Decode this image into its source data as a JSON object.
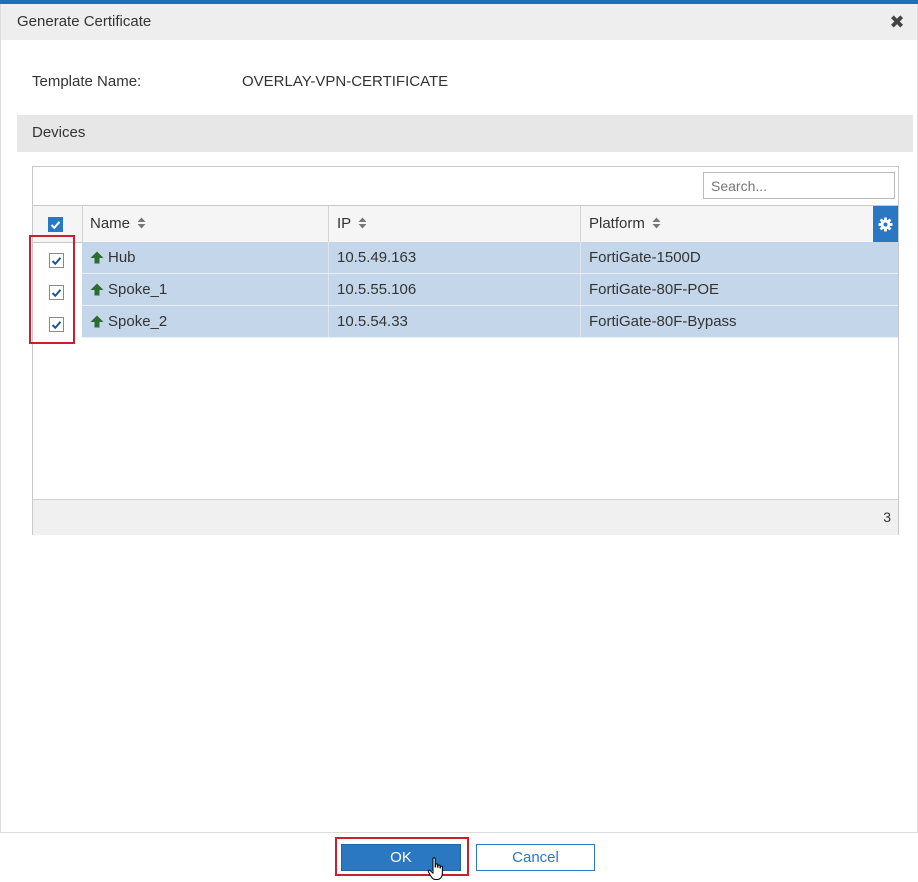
{
  "dialog": {
    "title": "Generate Certificate",
    "close_glyph": "✖"
  },
  "template": {
    "label": "Template Name:",
    "value": "OVERLAY-VPN-CERTIFICATE"
  },
  "devices_section": {
    "title": "Devices",
    "search_placeholder": "Search...",
    "columns": [
      {
        "label": "Name"
      },
      {
        "label": "IP"
      },
      {
        "label": "Platform"
      }
    ],
    "rows": [
      {
        "name": "Hub",
        "ip": "10.5.49.163",
        "platform": "FortiGate-1500D",
        "checked": true
      },
      {
        "name": "Spoke_1",
        "ip": "10.5.55.106",
        "platform": "FortiGate-80F-POE",
        "checked": true
      },
      {
        "name": "Spoke_2",
        "ip": "10.5.54.33",
        "platform": "FortiGate-80F-Bypass",
        "checked": true
      }
    ],
    "count": "3"
  },
  "buttons": {
    "ok": "OK",
    "cancel": "Cancel"
  },
  "colors": {
    "accent": "#2b78c2",
    "selected_row": "#c4d7ea",
    "highlight": "#c8202f",
    "status_up": "#2e6b2e"
  },
  "icons": {
    "close": "close-icon",
    "sort": "sort-icon",
    "settings": "gear-icon",
    "device_status": "arrow-up-icon",
    "checkbox": "checkmark-icon"
  }
}
